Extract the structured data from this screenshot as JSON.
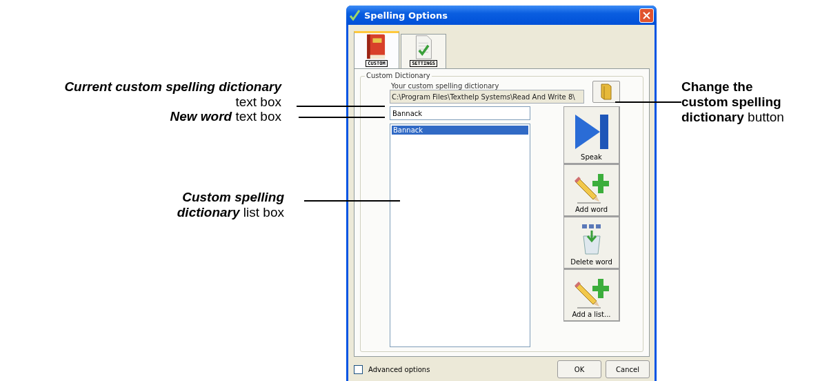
{
  "callouts": [
    {
      "kind": "left",
      "emphasis": "Current custom spelling dictionary",
      "rest": "text box"
    },
    {
      "kind": "left",
      "emphasis": "New word",
      "rest": "text box"
    },
    {
      "kind": "left",
      "emphasis": "Custom spelling dictionary",
      "rest": "list box"
    },
    {
      "kind": "right",
      "emphasis": "Change the custom spelling dictionary",
      "rest": "button"
    }
  ],
  "window": {
    "title": "Spelling Options"
  },
  "tabs": [
    {
      "label": "CUSTOM",
      "selected": true,
      "kind": "book"
    },
    {
      "label": "SETTINGS",
      "selected": false,
      "kind": "document"
    }
  ],
  "group": {
    "title": "Custom Dictionary",
    "path_label": "Your custom spelling dictionary",
    "path_value": "C:\\Program Files\\Texthelp Systems\\Read And Write 8\\",
    "new_word": "Bannack",
    "words": [
      {
        "text": "Bannack",
        "selected": true
      }
    ]
  },
  "actions": [
    {
      "label": "Speak",
      "kind": "speak"
    },
    {
      "label": "Add word",
      "kind": "add"
    },
    {
      "label": "Delete word",
      "kind": "delete"
    },
    {
      "label": "Add a list...",
      "kind": "add"
    }
  ],
  "advanced": {
    "label": "Advanced options",
    "checked": false
  },
  "buttons": [
    "OK",
    "Cancel"
  ]
}
